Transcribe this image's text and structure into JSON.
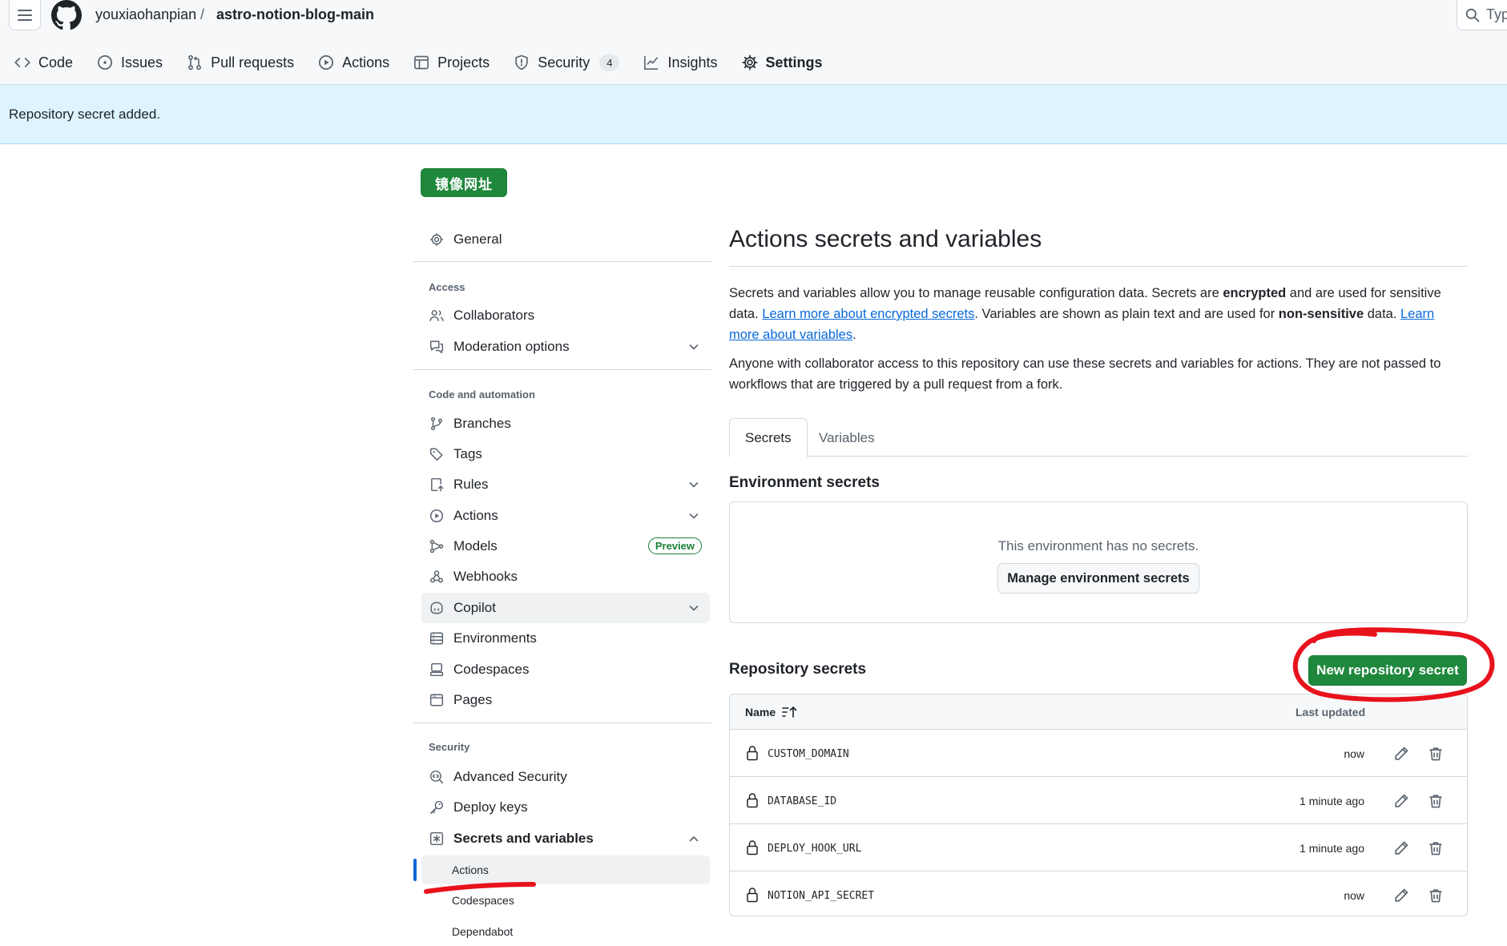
{
  "header": {
    "owner": "youxiaohanpian",
    "separator": "/",
    "repo": "astro-notion-blog-main",
    "search_placeholder": "Typ",
    "tabs": [
      {
        "label": "Code",
        "icon": "code-icon"
      },
      {
        "label": "Issues",
        "icon": "issue-opened-icon"
      },
      {
        "label": "Pull requests",
        "icon": "git-pull-request-icon"
      },
      {
        "label": "Actions",
        "icon": "play-icon"
      },
      {
        "label": "Projects",
        "icon": "table-icon"
      },
      {
        "label": "Security",
        "icon": "shield-icon",
        "count": "4"
      },
      {
        "label": "Insights",
        "icon": "graph-icon"
      },
      {
        "label": "Settings",
        "icon": "gear-icon",
        "active": true
      }
    ]
  },
  "flash": {
    "message": "Repository secret added."
  },
  "mirror_button": {
    "label": "镜像网址"
  },
  "sidebar": {
    "general": "General",
    "access_heading": "Access",
    "collaborators": "Collaborators",
    "moderation": "Moderation options",
    "code_heading": "Code and automation",
    "branches": "Branches",
    "tags": "Tags",
    "rules": "Rules",
    "actions": "Actions",
    "models": "Models",
    "models_badge": "Preview",
    "webhooks": "Webhooks",
    "copilot": "Copilot",
    "environments": "Environments",
    "codespaces": "Codespaces",
    "pages": "Pages",
    "security_heading": "Security",
    "advanced_security": "Advanced Security",
    "deploy_keys": "Deploy keys",
    "secrets_vars": "Secrets and variables",
    "sub_actions": "Actions",
    "sub_codespaces": "Codespaces",
    "sub_dependabot": "Dependabot"
  },
  "main": {
    "title": "Actions secrets and variables",
    "p1_a": "Secrets and variables allow you to manage reusable configuration data. Secrets are ",
    "p1_b": "encrypted",
    "p1_c": " and are used for sensitive data. ",
    "p1_link1": "Learn more about encrypted secrets",
    "p1_d": ". Variables are shown as plain text and are used for ",
    "p1_e": "non-sensitive",
    "p1_f": " data. ",
    "p1_link2": "Learn more about variables",
    "p1_g": ".",
    "p2": "Anyone with collaborator access to this repository can use these secrets and variables for actions. They are not passed to workflows that are triggered by a pull request from a fork.",
    "tab_secrets": "Secrets",
    "tab_variables": "Variables",
    "env_heading": "Environment secrets",
    "env_empty": "This environment has no secrets.",
    "env_manage": "Manage environment secrets",
    "repo_heading": "Repository secrets",
    "new_secret": "New repository secret",
    "col_name": "Name",
    "col_updated": "Last updated",
    "secrets": [
      {
        "name": "CUSTOM_DOMAIN",
        "updated": "now"
      },
      {
        "name": "DATABASE_ID",
        "updated": "1 minute ago"
      },
      {
        "name": "DEPLOY_HOOK_URL",
        "updated": "1 minute ago"
      },
      {
        "name": "NOTION_API_SECRET",
        "updated": "now"
      }
    ]
  },
  "colors": {
    "primary_green": "#1f883d",
    "flash_bg": "#ddf4ff",
    "link": "#0969da",
    "annotation_red": "#e8121c",
    "tab_underline": "#fd8c73"
  }
}
